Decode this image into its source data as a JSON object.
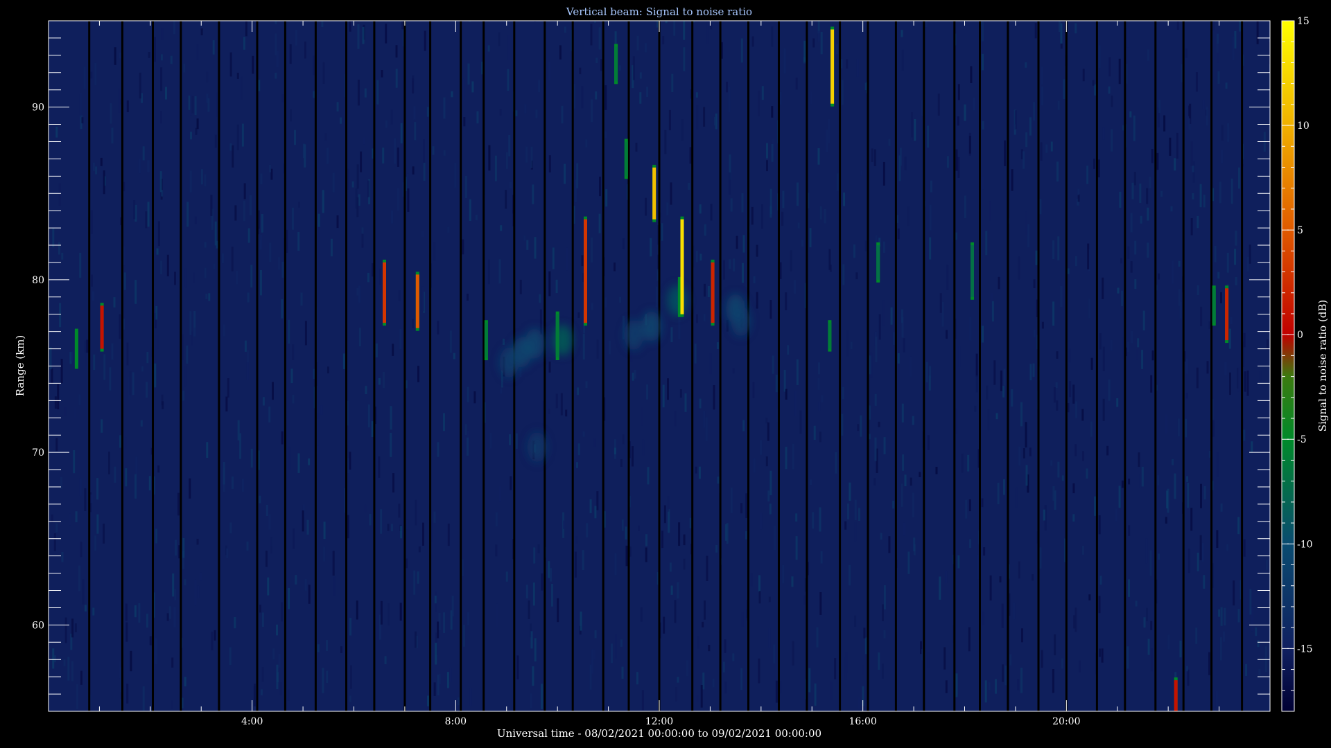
{
  "chart_data": {
    "type": "heatmap",
    "title": "Vertical beam: Signal to noise ratio",
    "xlabel": "Universal time - 08/02/2021 00:00:00 to 09/02/2021 00:00:00",
    "ylabel": "Range (km)",
    "colorbar_label": "Signal to noise ratio (dB)",
    "xlim": [
      0,
      24
    ],
    "ylim": [
      55,
      95
    ],
    "clim": [
      -18,
      15
    ],
    "x_ticks": [
      {
        "value": 4,
        "label": "4:00"
      },
      {
        "value": 8,
        "label": "8:00"
      },
      {
        "value": 12,
        "label": "12:00"
      },
      {
        "value": 16,
        "label": "16:00"
      },
      {
        "value": 20,
        "label": "20:00"
      }
    ],
    "y_ticks": [
      {
        "value": 60,
        "label": "60"
      },
      {
        "value": 70,
        "label": "70"
      },
      {
        "value": 80,
        "label": "80"
      },
      {
        "value": 90,
        "label": "90"
      }
    ],
    "colorbar_ticks": [
      {
        "value": 15,
        "label": "15"
      },
      {
        "value": 10,
        "label": "10"
      },
      {
        "value": 5,
        "label": "5"
      },
      {
        "value": 0,
        "label": "0"
      },
      {
        "value": -5,
        "label": "-5"
      },
      {
        "value": -10,
        "label": "-10"
      },
      {
        "value": -15,
        "label": "-15"
      }
    ],
    "colormap": [
      {
        "value": -18,
        "color": "#000033"
      },
      {
        "value": -15,
        "color": "#102060"
      },
      {
        "value": -10,
        "color": "#0a4b70"
      },
      {
        "value": -5,
        "color": "#008a2a"
      },
      {
        "value": -2,
        "color": "#3c7a10"
      },
      {
        "value": 0,
        "color": "#c00000"
      },
      {
        "value": 5,
        "color": "#e05a00"
      },
      {
        "value": 10,
        "color": "#f0b000"
      },
      {
        "value": 15,
        "color": "#ffff00"
      }
    ],
    "background_snr_db": -15,
    "echoes": [
      {
        "t": 0.55,
        "r0": 75.0,
        "r1": 77.0,
        "snr": -5
      },
      {
        "t": 1.05,
        "r0": 76.0,
        "r1": 78.5,
        "snr": 1
      },
      {
        "t": 6.6,
        "r0": 77.5,
        "r1": 81.0,
        "snr": 3
      },
      {
        "t": 7.25,
        "r0": 77.2,
        "r1": 80.3,
        "snr": 5
      },
      {
        "t": 8.6,
        "r0": 75.5,
        "r1": 77.5,
        "snr": -6
      },
      {
        "t": 10.0,
        "r0": 75.5,
        "r1": 78.0,
        "snr": -6
      },
      {
        "t": 10.55,
        "r0": 77.5,
        "r1": 83.5,
        "snr": 3
      },
      {
        "t": 11.15,
        "r0": 91.5,
        "r1": 93.5,
        "snr": -6
      },
      {
        "t": 11.35,
        "r0": 86.0,
        "r1": 88.0,
        "snr": -6
      },
      {
        "t": 11.9,
        "r0": 83.5,
        "r1": 86.5,
        "snr": 11
      },
      {
        "t": 12.4,
        "r0": 78.0,
        "r1": 80.0,
        "snr": -5
      },
      {
        "t": 12.45,
        "r0": 78.0,
        "r1": 83.5,
        "snr": 13
      },
      {
        "t": 13.05,
        "r0": 77.5,
        "r1": 81.0,
        "snr": 2
      },
      {
        "t": 15.4,
        "r0": 90.2,
        "r1": 94.5,
        "snr": 12
      },
      {
        "t": 15.35,
        "r0": 76.0,
        "r1": 77.5,
        "snr": -6
      },
      {
        "t": 16.3,
        "r0": 80.0,
        "r1": 82.0,
        "snr": -7
      },
      {
        "t": 18.15,
        "r0": 79.0,
        "r1": 82.0,
        "snr": -7
      },
      {
        "t": 22.9,
        "r0": 77.5,
        "r1": 79.5,
        "snr": -6
      },
      {
        "t": 23.15,
        "r0": 76.5,
        "r1": 79.5,
        "snr": 2
      },
      {
        "t": 22.15,
        "r0": 55.0,
        "r1": 56.8,
        "snr": 1
      }
    ],
    "diffuse_patches": [
      {
        "t": 9.3,
        "r": 75.8,
        "snr": -10
      },
      {
        "t": 9.05,
        "r": 75.2,
        "snr": -11
      },
      {
        "t": 9.55,
        "r": 76.3,
        "snr": -10
      },
      {
        "t": 10.1,
        "r": 76.5,
        "snr": -8
      },
      {
        "t": 11.5,
        "r": 76.8,
        "snr": -11
      },
      {
        "t": 11.85,
        "r": 77.3,
        "snr": -10
      },
      {
        "t": 12.35,
        "r": 78.8,
        "snr": -9
      },
      {
        "t": 13.5,
        "r": 78.3,
        "snr": -10
      },
      {
        "t": 13.6,
        "r": 77.6,
        "snr": -11
      },
      {
        "t": 9.6,
        "r": 70.3,
        "snr": -12
      }
    ],
    "data_gaps_hours": [
      0.8,
      1.45,
      2.05,
      2.6,
      3.35,
      4.1,
      4.65,
      5.25,
      5.85,
      6.4,
      7.0,
      7.5,
      8.1,
      8.55,
      9.15,
      9.75,
      10.3,
      10.9,
      11.4,
      12.0,
      12.65,
      13.2,
      13.75,
      14.35,
      14.9,
      15.55,
      16.1,
      16.65,
      17.2,
      17.8,
      18.3,
      18.85,
      19.45,
      20.0,
      20.6,
      21.15,
      21.75,
      22.3,
      22.85,
      23.45
    ]
  }
}
